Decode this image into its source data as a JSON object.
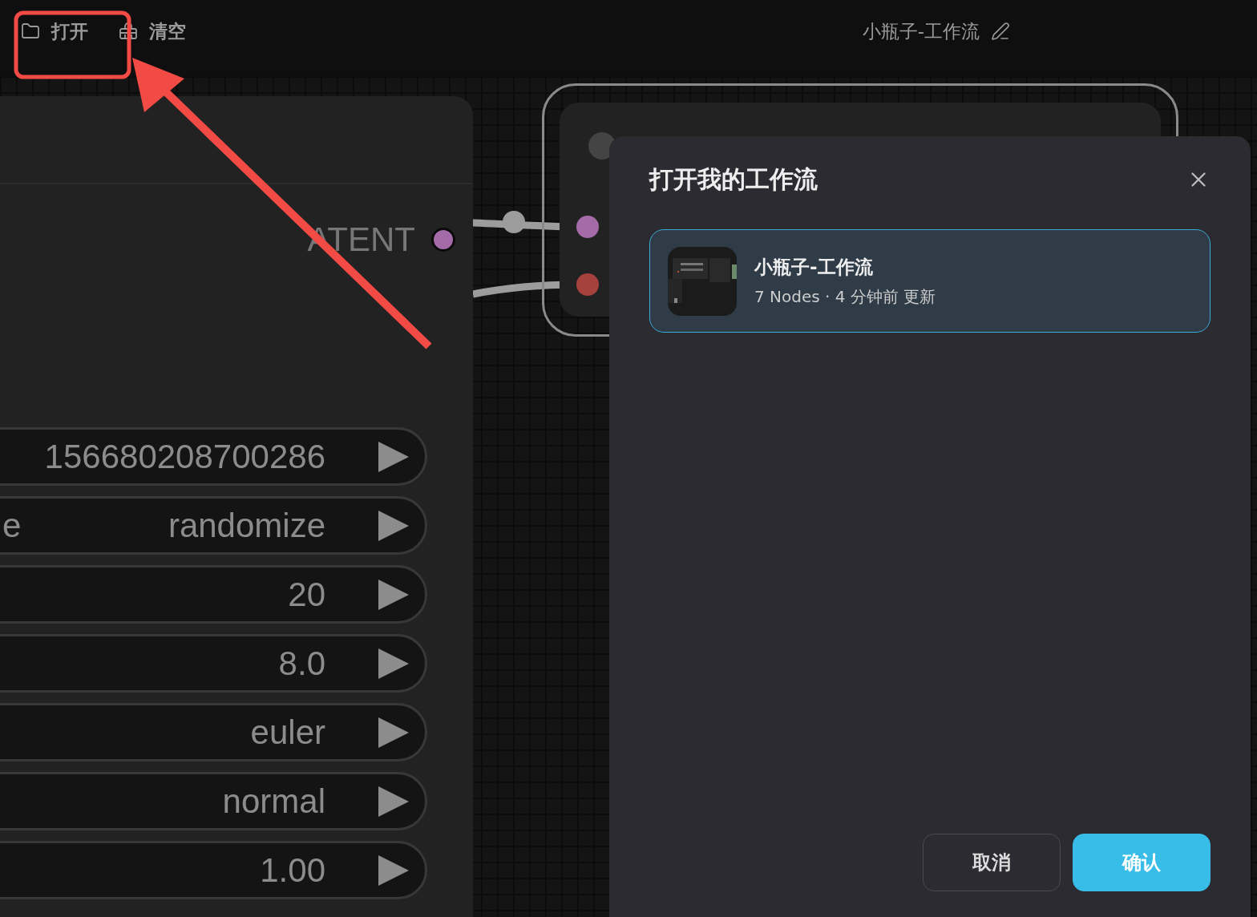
{
  "toolbar": {
    "buttons": [
      {
        "kind": "open",
        "label": "打开"
      },
      {
        "kind": "clear",
        "label": "清空"
      }
    ],
    "workflow_title": "小瓶子-工作流"
  },
  "canvas": {
    "sampler_node": {
      "output_label": "ATENT",
      "widgets": [
        {
          "value": "156680208700286"
        },
        {
          "label": "e",
          "value": "randomize"
        },
        {
          "value": "20"
        },
        {
          "value": "8.0"
        },
        {
          "value": "euler"
        },
        {
          "value": "normal"
        },
        {
          "value": "1.00"
        }
      ]
    },
    "vae_node": {
      "inputs": [
        {
          "color": "#a56aa8"
        },
        {
          "color": "#a7413d"
        }
      ]
    }
  },
  "dialog": {
    "title": "打开我的工作流",
    "workflows": [
      {
        "name": "小瓶子-工作流",
        "meta": "7 Nodes · 4 分钟前 更新",
        "selected": true
      }
    ],
    "buttons": [
      {
        "kind": "secondary",
        "label": "取消"
      },
      {
        "kind": "primary",
        "label": "确认"
      }
    ]
  }
}
